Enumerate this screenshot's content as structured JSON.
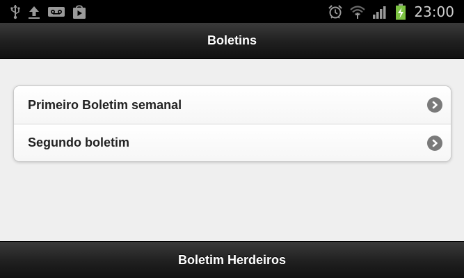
{
  "status_bar": {
    "left_icons": [
      "usb-icon",
      "upload-icon",
      "voicemail-icon",
      "play-store-icon"
    ],
    "right_icons": [
      "alarm-icon",
      "wifi-icon",
      "signal-icon",
      "battery-charging-icon"
    ],
    "time": "23:00"
  },
  "header": {
    "title": "Boletins"
  },
  "list": {
    "items": [
      {
        "label": "Primeiro Boletim semanal",
        "icon": "chevron-right-icon"
      },
      {
        "label": "Segundo boletim",
        "icon": "chevron-right-icon"
      }
    ]
  },
  "footer": {
    "title": "Boletim Herdeiros"
  },
  "colors": {
    "bar_background": "#1f1f1f",
    "content_background": "#efefef",
    "chevron": "#7a7a7a",
    "battery_green": "#7cc242"
  }
}
